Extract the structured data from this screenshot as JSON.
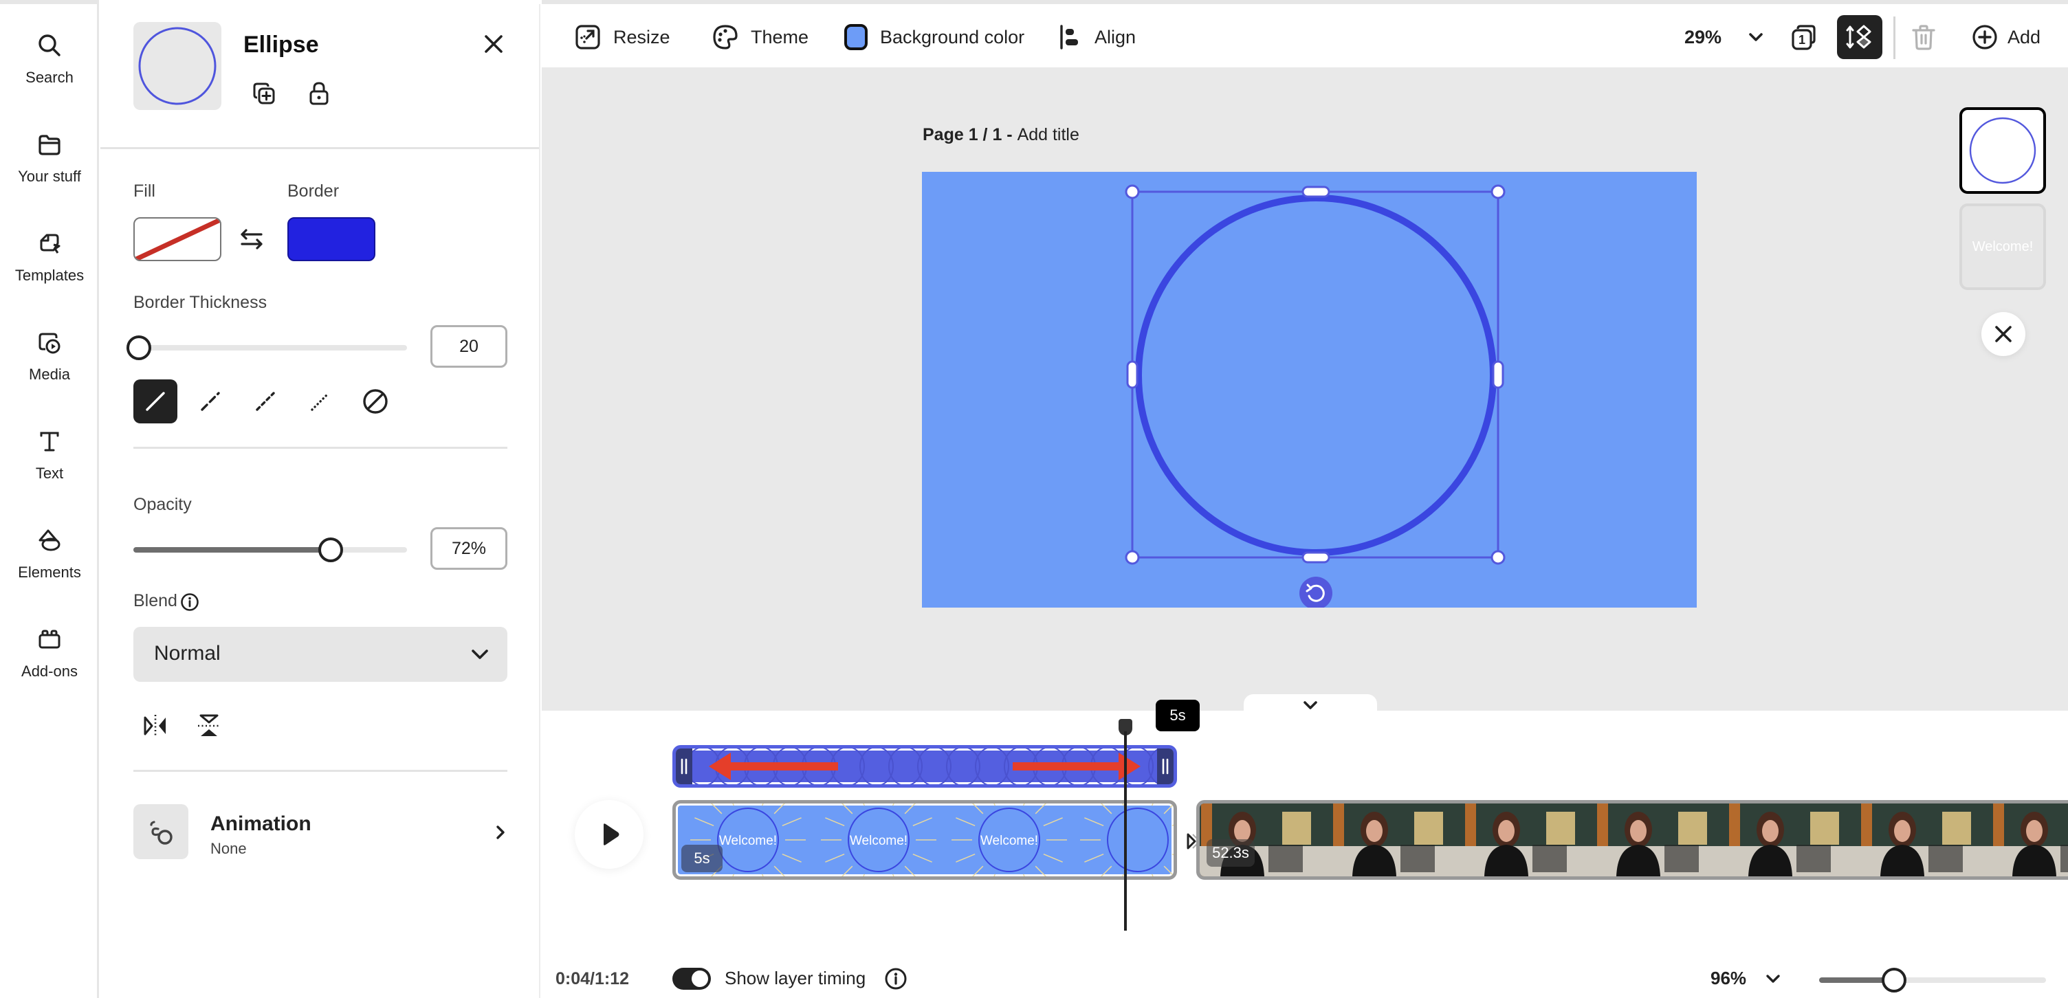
{
  "rail": {
    "items": [
      {
        "label": "Search",
        "icon": "search-icon"
      },
      {
        "label": "Your stuff",
        "icon": "folder-icon"
      },
      {
        "label": "Templates",
        "icon": "templates-icon"
      },
      {
        "label": "Media",
        "icon": "media-icon"
      },
      {
        "label": "Text",
        "icon": "text-icon"
      },
      {
        "label": "Elements",
        "icon": "elements-icon"
      },
      {
        "label": "Add-ons",
        "icon": "addons-icon"
      }
    ]
  },
  "panel": {
    "title": "Ellipse",
    "fill_label": "Fill",
    "border_label": "Border",
    "fill_color": "none",
    "border_color": "#2222e0",
    "border_thickness_label": "Border Thickness",
    "border_thickness_value": "20",
    "border_thickness_fraction": 0.02,
    "border_styles": [
      "solid",
      "dashed-long",
      "dashed",
      "dotted",
      "none"
    ],
    "border_style_selected": "solid",
    "opacity_label": "Opacity",
    "opacity_value": "72%",
    "opacity_fraction": 0.72,
    "blend_label": "Blend",
    "blend_value": "Normal",
    "animation_label": "Animation",
    "animation_value": "None"
  },
  "toolbar": {
    "resize": "Resize",
    "theme": "Theme",
    "background_color": "Background color",
    "background_swatch": "#6d9cf7",
    "align": "Align",
    "zoom": "29%",
    "pages_count": "1",
    "add": "Add"
  },
  "canvas": {
    "page_prefix": "Page 1 / 1 - ",
    "page_title_placeholder": "Add title",
    "artboard_color": "#6d9cf7",
    "ellipse_stroke": "#3a46e0",
    "selection_color": "#5358dd"
  },
  "page_thumbs": [
    {
      "kind": "ellipse",
      "selected": true
    },
    {
      "kind": "text",
      "text": "Welcome!",
      "selected": false
    }
  ],
  "timeline": {
    "tooltip": "5s",
    "scene1_duration": "5s",
    "scene1_label": "Welcome!",
    "scene2_duration": "52.3s",
    "time": "0:04/1:12",
    "show_layer_timing_label": "Show layer timing",
    "show_layer_timing_on": true,
    "zoom": "96%",
    "zoom_fraction": 0.33
  }
}
